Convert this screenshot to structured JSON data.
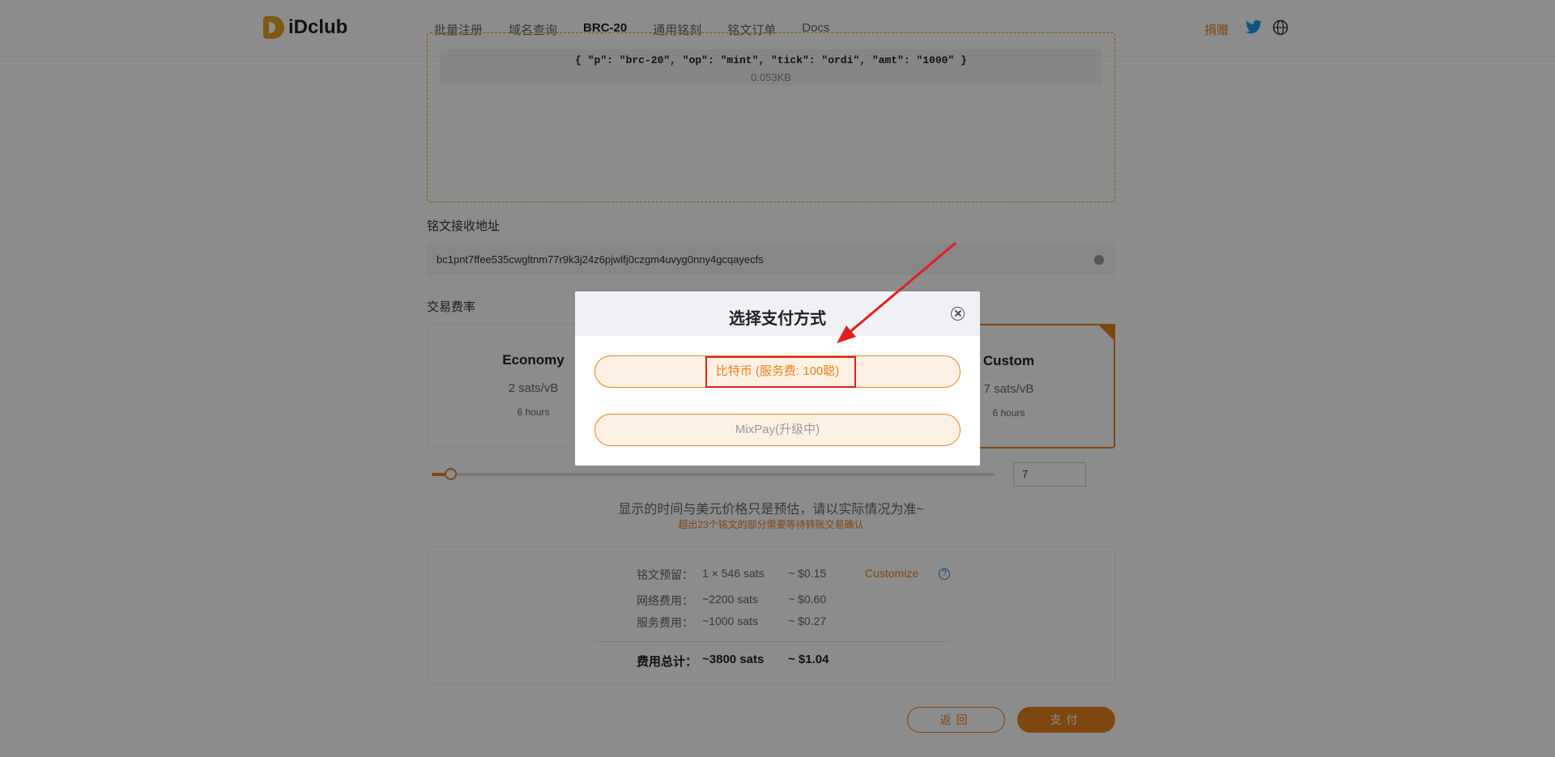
{
  "header": {
    "logo_text": "iDclub",
    "nav": [
      "批量注册",
      "域名查询",
      "BRC-20",
      "通用铭刻",
      "铭文订单",
      "Docs"
    ],
    "donate_label": "捐赠"
  },
  "preview": {
    "code": "{ \"p\": \"brc-20\", \"op\": \"mint\", \"tick\": \"ordi\", \"amt\": \"1000\" }",
    "size": "0.053KB"
  },
  "address": {
    "label": "铭文接收地址",
    "value": "bc1pnt7ffee535cwgltnm77r9k3j24z6pjwlfj0czgm4uvyg0nny4gcqayecfs"
  },
  "fee": {
    "label": "交易费率",
    "cards": [
      {
        "title": "Economy",
        "rate": "2 sats/vB",
        "time": "6 hours"
      },
      {
        "title": "Custom",
        "rate": "7 sats/vB",
        "time": "6 hours"
      }
    ],
    "slider_value": 7,
    "custom_input": "7"
  },
  "notes": {
    "estimate": "显示的时间与美元价格只是预估，请以实际情况为准~",
    "warning": "超出23个铭文的部分需要等待转账交易确认"
  },
  "costs": {
    "rows": [
      {
        "label": "铭文预留：",
        "sats": "1 × 546  sats",
        "usd": "~ $0.15"
      },
      {
        "label": "网络费用：",
        "sats": "~2200  sats",
        "usd": "~ $0.60"
      },
      {
        "label": "服务费用：",
        "sats": "~1000  sats",
        "usd": "~ $0.27"
      }
    ],
    "total": {
      "label": "费用总计：",
      "sats": "~3800  sats",
      "usd": "~ $1.04"
    },
    "customize_label": "Customize",
    "help_glyph": "?"
  },
  "buttons": {
    "back": "返回",
    "pay": "支付"
  },
  "modal": {
    "title": "选择支付方式",
    "options": [
      "比特币 (服务费: 100聪)",
      "MixPay(升级中)"
    ]
  },
  "colors": {
    "accent": "#e8821e",
    "highlight": "#e02020"
  }
}
